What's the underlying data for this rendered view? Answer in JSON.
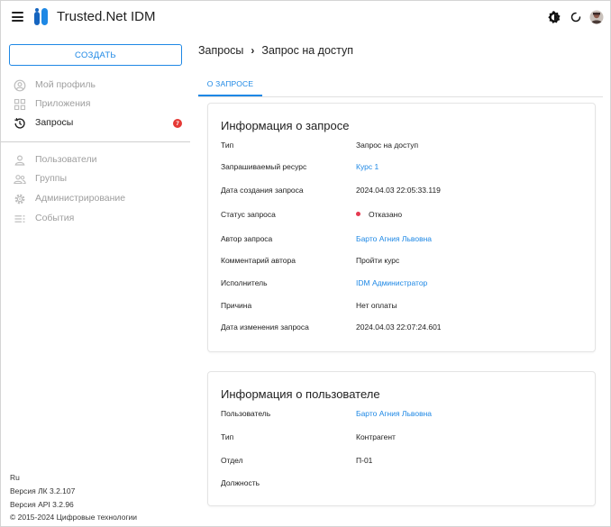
{
  "app": {
    "title": "Trusted.Net IDM"
  },
  "sidebar": {
    "create_label": "СОЗДАТЬ",
    "items": [
      {
        "label": "Мой профиль",
        "icon": "user-circle-icon"
      },
      {
        "label": "Приложения",
        "icon": "apps-grid-icon"
      },
      {
        "label": "Запросы",
        "icon": "history-icon",
        "badge": "7",
        "active": true
      },
      {
        "label": "Пользователи",
        "icon": "user-icon"
      },
      {
        "label": "Группы",
        "icon": "group-icon"
      },
      {
        "label": "Администрирование",
        "icon": "gear-icon"
      },
      {
        "label": "События",
        "icon": "events-list-icon"
      }
    ],
    "footer": {
      "lang": "Ru",
      "version_lk": "Версия ЛК 3.2.107",
      "version_api": "Версия API 3.2.96",
      "copyright": "© 2015-2024 Цифровые технологии"
    }
  },
  "breadcrumb": {
    "parent": "Запросы",
    "separator": "›",
    "current": "Запрос на доступ"
  },
  "tabs": [
    {
      "label": "О ЗАПРОСЕ",
      "active": true
    }
  ],
  "request_info": {
    "title": "Информация о запросе",
    "rows": [
      {
        "key": "Тип",
        "value": "Запрос на доступ"
      },
      {
        "key": "Запрашиваемый ресурс",
        "value": "Курс 1",
        "link": true
      },
      {
        "key": "Дата создания запроса",
        "value": "2024.04.03 22:05:33.119"
      },
      {
        "key": "Статус запроса",
        "value": "Отказано",
        "status_color": "#e53950"
      },
      {
        "key": "Автор запроса",
        "value": "Барто Агния Львовна",
        "link": true
      },
      {
        "key": "Комментарий автора",
        "value": "Пройти курс"
      },
      {
        "key": "Исполнитель",
        "value": "IDM Администратор",
        "link": true
      },
      {
        "key": "Причина",
        "value": "Нет оплаты"
      },
      {
        "key": "Дата изменения запроса",
        "value": "2024.04.03 22:07:24.601"
      }
    ]
  },
  "user_info": {
    "title": "Информация о пользователе",
    "rows": [
      {
        "key": "Пользователь",
        "value": "Барто Агния Львовна",
        "link": true
      },
      {
        "key": "Тип",
        "value": "Контрагент"
      },
      {
        "key": "Отдел",
        "value": "П-01"
      },
      {
        "key": "Должность",
        "value": ""
      }
    ]
  },
  "colors": {
    "accent": "#1e88e5",
    "badge": "#e53935",
    "status_rejected": "#e53950"
  }
}
